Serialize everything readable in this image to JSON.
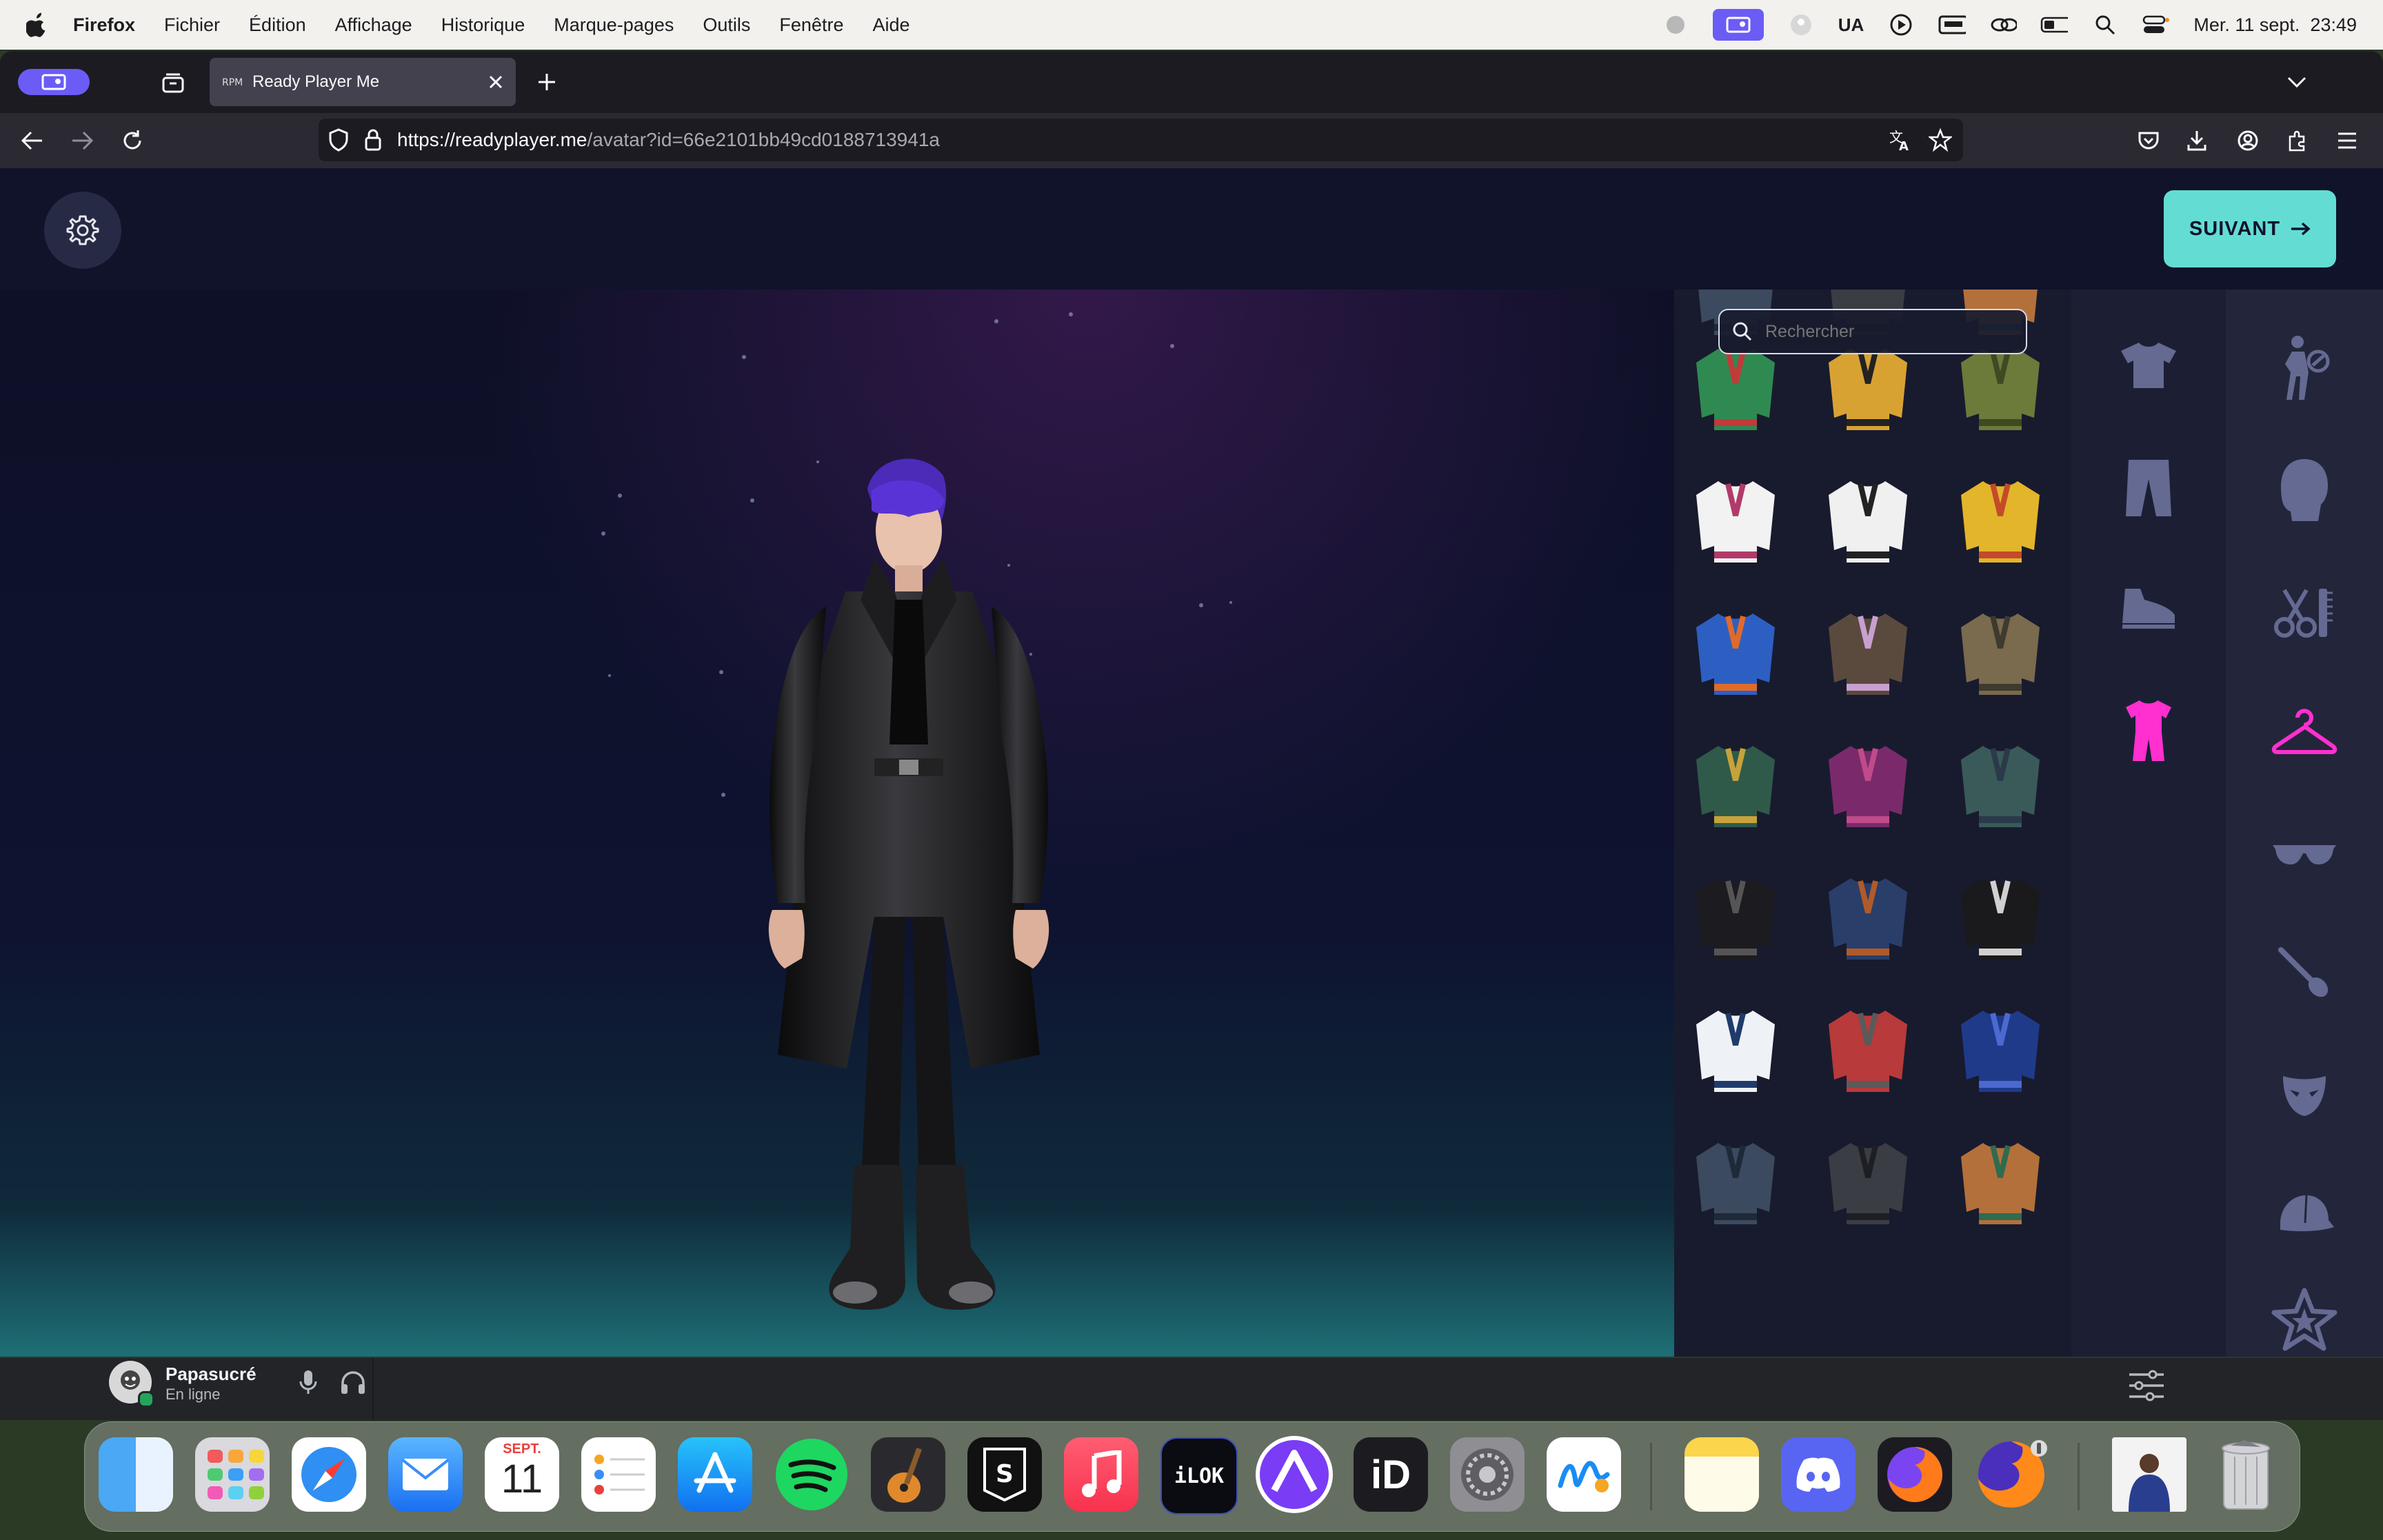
{
  "menubar": {
    "app_name": "Firefox",
    "items": [
      "Fichier",
      "Édition",
      "Affichage",
      "Historique",
      "Marque-pages",
      "Outils",
      "Fenêtre",
      "Aide"
    ],
    "input_source": "UA",
    "clock": "Mer. 11 sept.  23:49"
  },
  "browser": {
    "tab_title": "Ready Player Me",
    "url_host": "https://readyplayer.me",
    "url_path": "/avatar?id=66e2101bb49cd0188713941a"
  },
  "page": {
    "next_button_label": "SUIVANT",
    "search_placeholder": "Rechercher",
    "accent_color": "#63ddd3",
    "highlight_color": "#ff2fd0",
    "outfit_grid_rows": 8,
    "outfit_grid_cols": 3
  },
  "statusbar": {
    "user_name": "Papasucré",
    "user_status": "En ligne"
  },
  "dock": {
    "calendar_month": "SEPT.",
    "calendar_day": "11",
    "ilok_label": "iLOK",
    "id_label": "iD"
  }
}
